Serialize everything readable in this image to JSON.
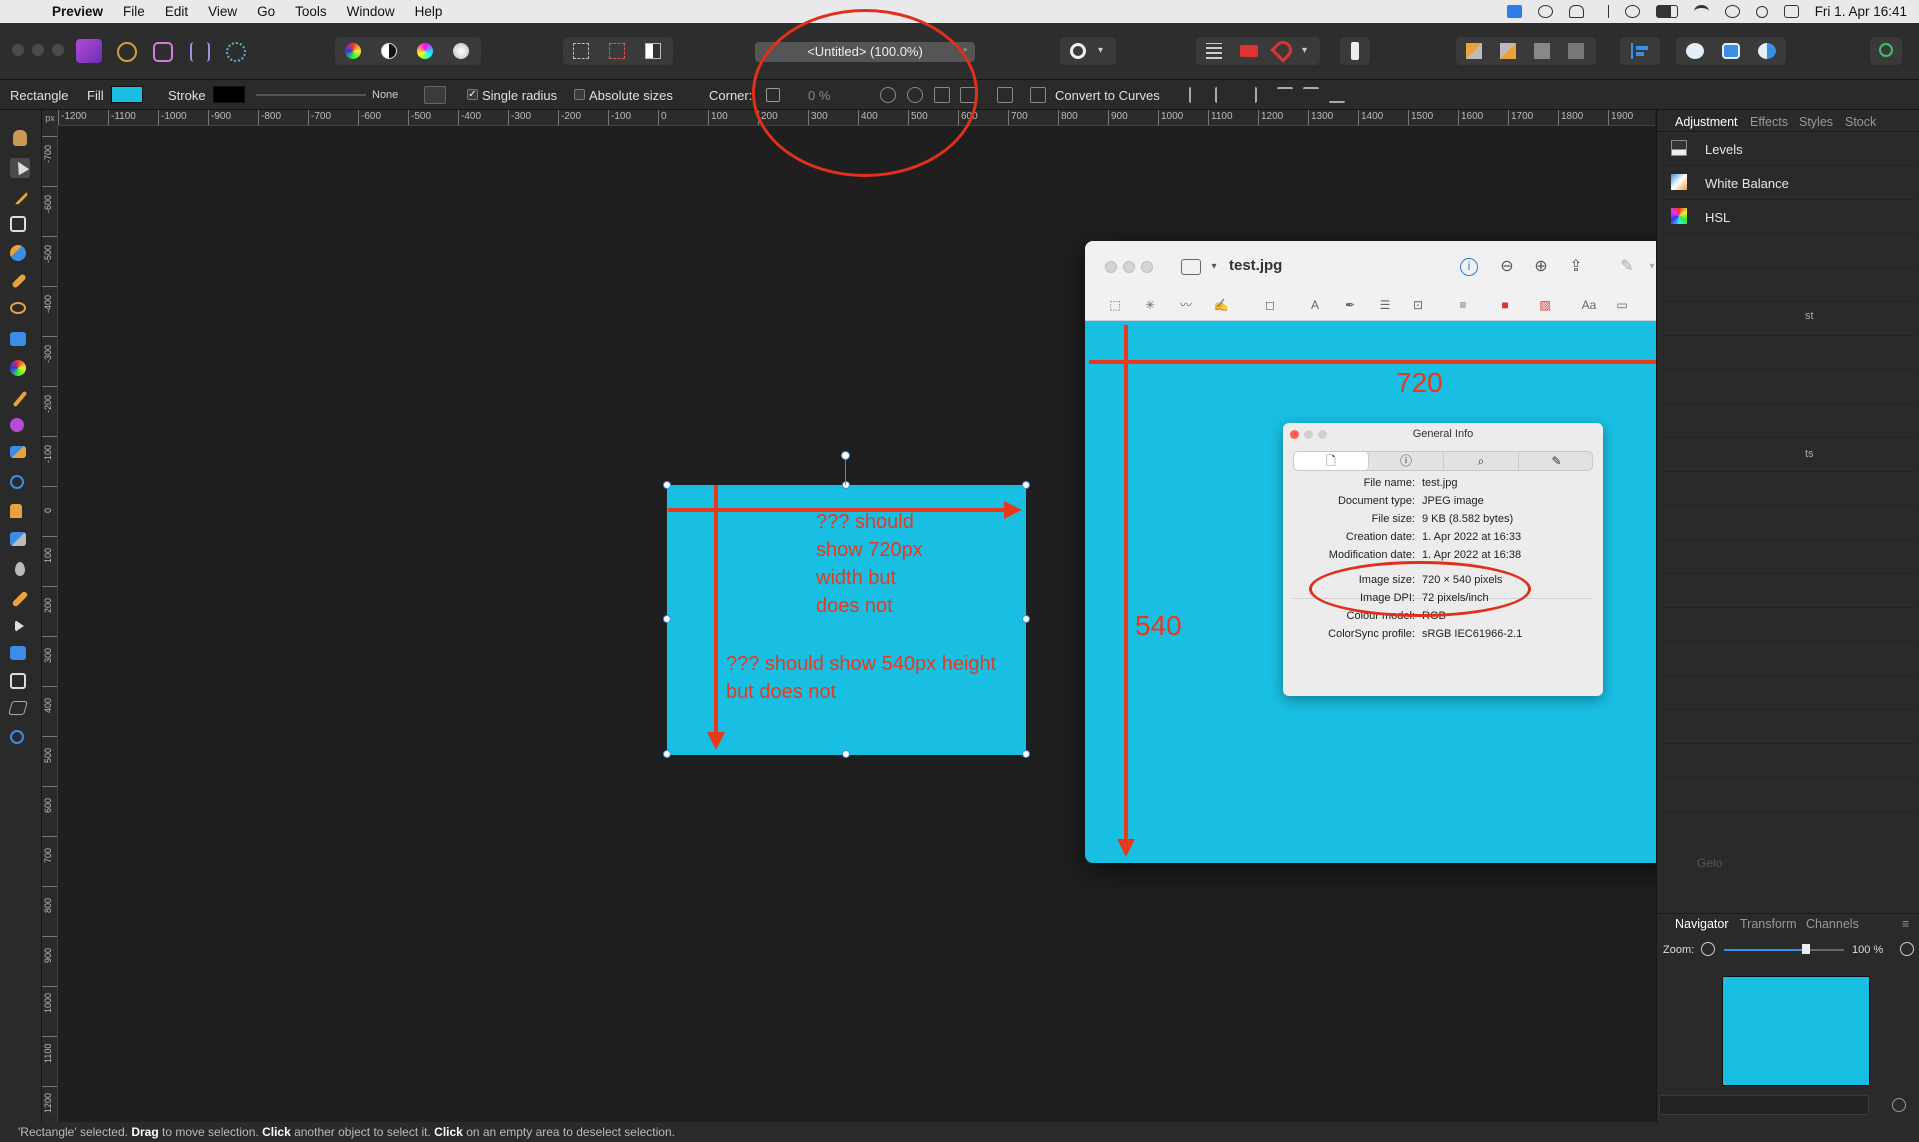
{
  "menubar": {
    "app": "Preview",
    "menus": [
      "File",
      "Edit",
      "View",
      "Go",
      "Tools",
      "Window",
      "Help"
    ],
    "datetime": "Fri 1. Apr  16:41"
  },
  "toolbar": {
    "doc_title": "<Untitled> (100.0%)",
    "doc_title_modified": "*"
  },
  "context": {
    "tool_name": "Rectangle",
    "fill_label": "Fill",
    "stroke_label": "Stroke",
    "stroke_none": "None",
    "single_radius": "Single radius",
    "absolute_sizes": "Absolute sizes",
    "corner_label": "Corner:",
    "corner_value": "0 %",
    "convert_label": "Convert to Curves",
    "fill_color": "#19bfe3",
    "stroke_color": "#000000"
  },
  "ruler": {
    "unit": "px",
    "h_labels": [
      "-1200",
      "-1100",
      "-1000",
      "-900",
      "-800",
      "-700",
      "-600",
      "-500",
      "-400",
      "-300",
      "-200",
      "-100",
      "0",
      "100",
      "200",
      "300",
      "400",
      "500",
      "600",
      "700",
      "800",
      "900",
      "1000",
      "1100",
      "1200",
      "1300",
      "1400",
      "1500",
      "1600",
      "1700",
      "1800",
      "1900"
    ],
    "v_labels": [
      "-700",
      "-600",
      "-500",
      "-400",
      "-300",
      "-200",
      "-100",
      "0",
      "100",
      "200",
      "300",
      "400",
      "500",
      "600",
      "700",
      "800",
      "900",
      "1000",
      "1100",
      "1200"
    ]
  },
  "panel": {
    "tabs": [
      "Adjustment",
      "Effects",
      "Styles",
      "Stock"
    ],
    "adjustments": [
      "Levels",
      "White Balance",
      "HSL"
    ],
    "partial_right_1": "st",
    "partial_right_2": "ts",
    "partial_bottom": "Gelo",
    "nav_tabs": [
      "Navigator",
      "Transform",
      "Channels"
    ],
    "zoom_label": "Zoom:",
    "zoom_value": "100 %"
  },
  "canvas": {
    "annotation_width": "??? should\nshow 720px\nwidth but\ndoes not",
    "annotation_height": "??? should show 540px height\nbut does not"
  },
  "preview": {
    "title": "test.jpg",
    "label_720": "720",
    "label_540": "540",
    "info": {
      "title": "General Info",
      "rows": [
        {
          "k": "File name:",
          "v": "test.jpg"
        },
        {
          "k": "Document type:",
          "v": "JPEG image"
        },
        {
          "k": "File size:",
          "v": "9 KB (8.582 bytes)"
        },
        {
          "k": "Creation date:",
          "v": "1. Apr 2022 at 16:33"
        },
        {
          "k": "Modification date:",
          "v": "1. Apr 2022 at 16:38"
        },
        {
          "k": "Image size:",
          "v": "720 × 540 pixels"
        },
        {
          "k": "Image DPI:",
          "v": "72 pixels/inch"
        },
        {
          "k": "Colour model:",
          "v": "RGB"
        },
        {
          "k": "ColorSync profile:",
          "v": "sRGB IEC61966-2.1"
        }
      ]
    }
  },
  "status": {
    "s1": "'Rectangle' selected. ",
    "b1": "Drag",
    "s2": " to move selection. ",
    "b2": "Click",
    "s3": " another object to select it. ",
    "b3": "Click",
    "s4": " on an empty area to deselect selection."
  },
  "colors": {
    "annotation": "#e8391d",
    "shape_fill": "#19bfe3"
  }
}
